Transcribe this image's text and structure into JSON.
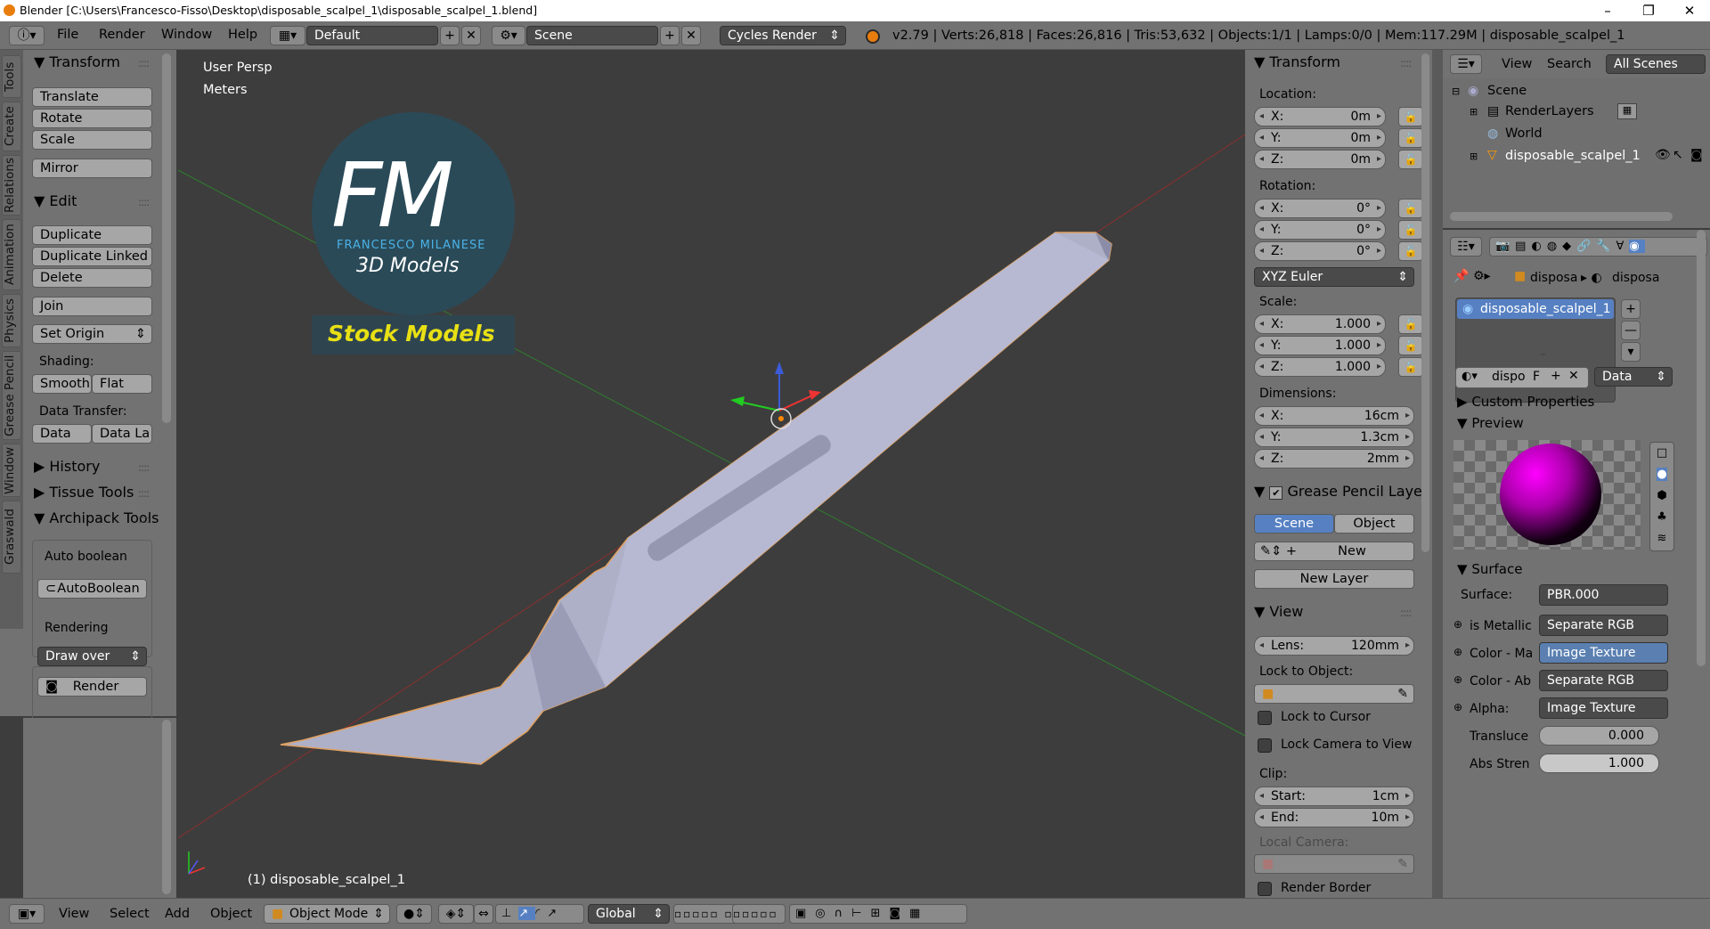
{
  "window": {
    "title": "Blender [C:\\Users\\Francesco-Fisso\\Desktop\\disposable_scalpel_1\\disposable_scalpel_1.blend]",
    "minimize": "–",
    "maximize": "❐",
    "close": "✕"
  },
  "menu": {
    "file": "File",
    "render": "Render",
    "window": "Window",
    "help": "Help"
  },
  "screen_layout": "Default",
  "scene": "Scene",
  "engine": "Cycles Render",
  "stats": "v2.79 | Verts:26,818 | Faces:26,816 | Tris:53,632 | Objects:1/1 | Lamps:0/0 | Mem:117.29M | disposable_scalpel_1",
  "tabs": [
    "Tools",
    "Create",
    "Relations",
    "Animation",
    "Physics",
    "Grease Pencil",
    "Window",
    "Graswald"
  ],
  "tools": {
    "transform_header": "Transform",
    "translate": "Translate",
    "rotate": "Rotate",
    "scale": "Scale",
    "mirror": "Mirror",
    "edit_header": "Edit",
    "duplicate": "Duplicate",
    "duplicate_linked": "Duplicate Linked",
    "delete": "Delete",
    "join": "Join",
    "set_origin": "Set Origin",
    "shading_label": "Shading:",
    "smooth": "Smooth",
    "flat": "Flat",
    "data_transfer_label": "Data Transfer:",
    "data": "Data",
    "data_la": "Data La",
    "history": "History",
    "tissue": "Tissue Tools",
    "archipack": "Archipack Tools",
    "auto_boolean_label": "Auto boolean",
    "autoboolean": "AutoBoolean",
    "rendering_label": "Rendering",
    "draw_over": "Draw over",
    "render": "Render"
  },
  "viewport": {
    "view_name": "User Persp",
    "units": "Meters",
    "object_label": "(1) disposable_scalpel_1",
    "logo_fm": "FM",
    "logo_name": "FRANCESCO MILANESE",
    "logo_sub": "3D Models",
    "logo_stock": "Stock Models"
  },
  "npanel": {
    "transform": "Transform",
    "location": "Location:",
    "loc_x": "0m",
    "loc_y": "0m",
    "loc_z": "0m",
    "rotation": "Rotation:",
    "rot_x": "0°",
    "rot_y": "0°",
    "rot_z": "0°",
    "rot_mode": "XYZ Euler",
    "scale": "Scale:",
    "sc_x": "1.000",
    "sc_y": "1.000",
    "sc_z": "1.000",
    "dimensions": "Dimensions:",
    "dim_x": "16cm",
    "dim_y": "1.3cm",
    "dim_z": "2mm",
    "gp_layer": "Grease Pencil Layer",
    "gp_scene": "Scene",
    "gp_object": "Object",
    "gp_new": "New",
    "gp_new_layer": "New Layer",
    "view": "View",
    "lens_k": "Lens:",
    "lens_v": "120mm",
    "lock_to_object": "Lock to Object:",
    "lock_cursor": "Lock to Cursor",
    "lock_camera": "Lock Camera to View",
    "clip": "Clip:",
    "start_k": "Start:",
    "start_v": "1cm",
    "end_k": "End:",
    "end_v": "10m",
    "local_camera": "Local Camera:",
    "render_border": "Render Border",
    "x": "X:",
    "y": "Y:",
    "z": "Z:"
  },
  "outliner": {
    "view": "View",
    "search": "Search",
    "filter": "All Scenes",
    "scene": "Scene",
    "renderlayers": "RenderLayers",
    "world": "World",
    "object": "disposable_scalpel_1"
  },
  "props": {
    "crumb1": "disposa",
    "crumb2": "disposa",
    "material_slot": "disposable_scalpel_1",
    "mat_name": "dispo",
    "mat_f": "F",
    "link": "Data",
    "custom_props": "Custom Properties",
    "preview": "Preview",
    "surface": "Surface",
    "surface_label": "Surface:",
    "surface_val": "PBR.000",
    "is_metallic": "is Metallic",
    "is_metallic_v": "Separate RGB",
    "color_ma": "Color - Ma",
    "color_ma_v": "Image Texture",
    "color_ab": "Color - Ab",
    "color_ab_v": "Separate RGB",
    "alpha": "Alpha:",
    "alpha_v": "Image Texture",
    "transluce": "Transluce",
    "transluce_v": "0.000",
    "abs_stren": "Abs Stren",
    "abs_stren_v": "1.000"
  },
  "bottom": {
    "view": "View",
    "select": "Select",
    "add": "Add",
    "object": "Object",
    "mode": "Object Mode",
    "orientation": "Global"
  }
}
